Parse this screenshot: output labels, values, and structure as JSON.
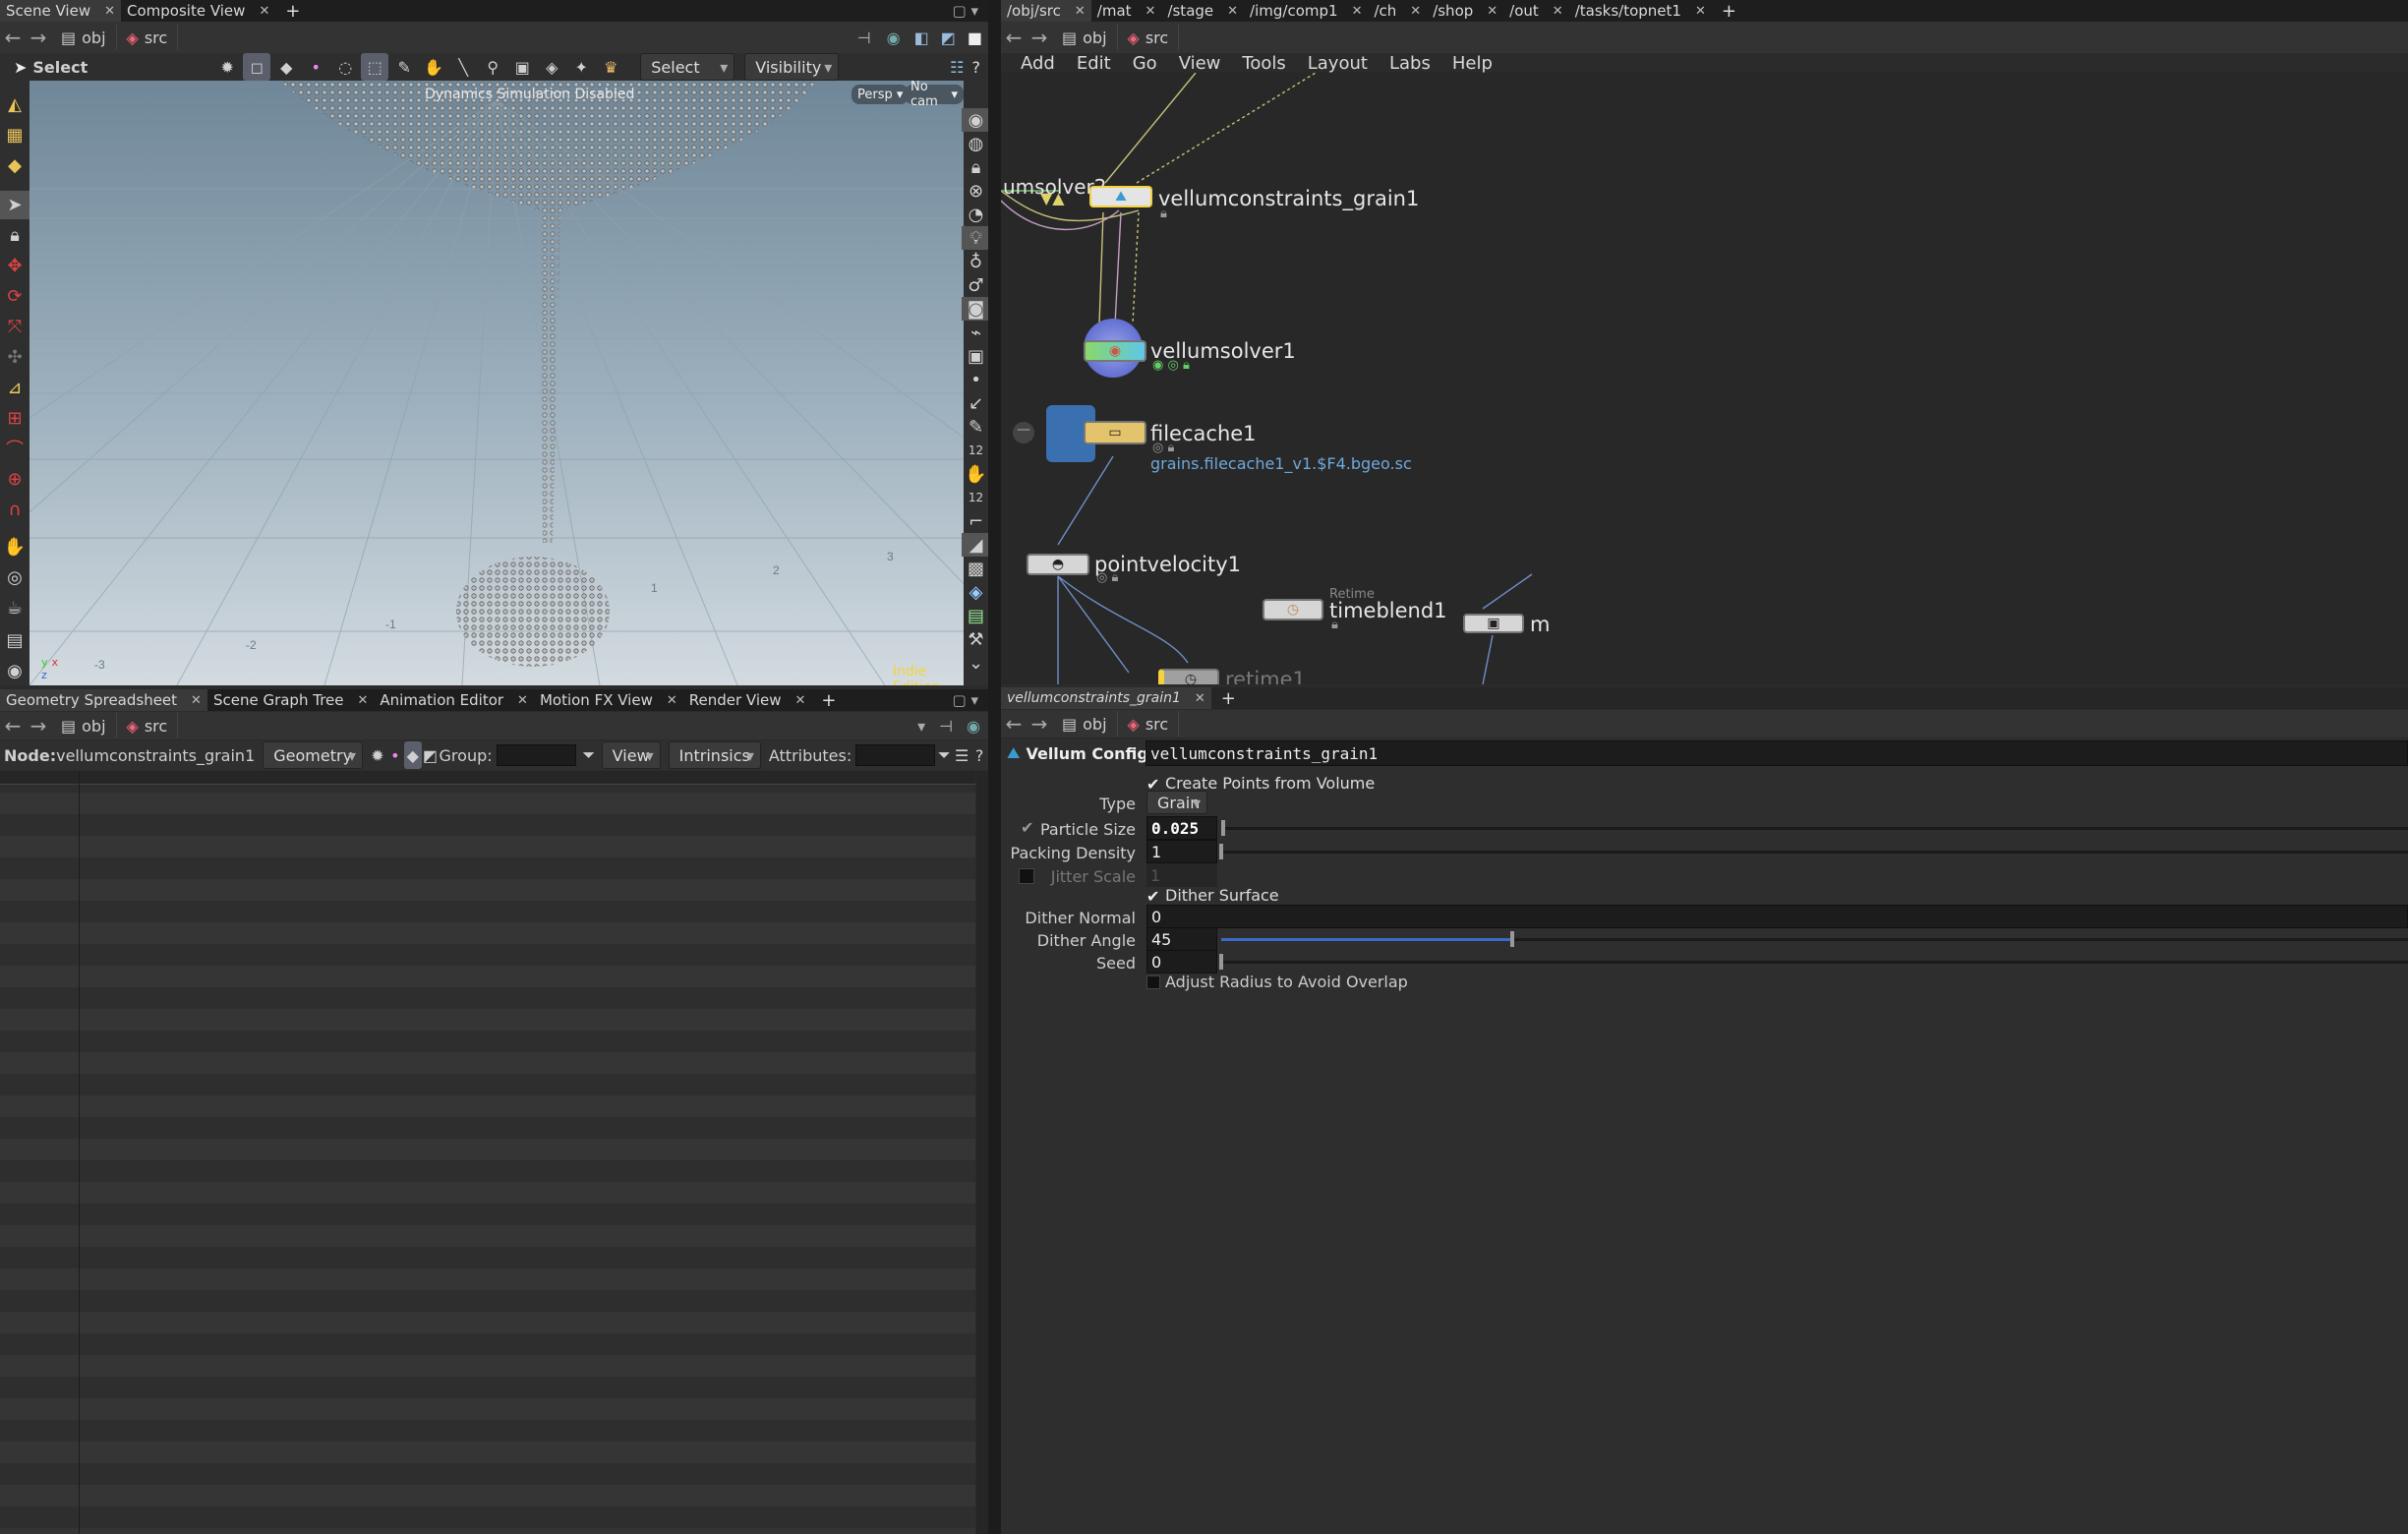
{
  "left_tabs": {
    "items": [
      "Scene View",
      "Composite View"
    ],
    "active": 0
  },
  "path": {
    "obj": "obj",
    "src": "src"
  },
  "toolbar": {
    "mode": "Select",
    "select_dd": "Select",
    "visibility_dd": "Visibility"
  },
  "viewport": {
    "status": "Dynamics Simulation Disabled",
    "persp": "Persp",
    "cam": "No cam",
    "edition": "Indie Edition",
    "grid_labels": [
      "-1",
      "-2",
      "-3",
      "1",
      "2",
      "3"
    ]
  },
  "bottom_tabs": {
    "items": [
      "Geometry Spreadsheet",
      "Scene Graph Tree",
      "Animation Editor",
      "Motion FX View",
      "Render View"
    ],
    "active": 0
  },
  "spreadsheet": {
    "node_label": "Node:",
    "node_name": "vellumconstraints_grain1",
    "geometry_dd": "Geometry",
    "group_label": "Group:",
    "view_dd": "View",
    "intrinsics_dd": "Intrinsics",
    "attributes_label": "Attributes:"
  },
  "network_tabs": {
    "items": [
      "/obj/src",
      "/mat",
      "/stage",
      "/img/comp1",
      "/ch",
      "/shop",
      "/out",
      "/tasks/topnet1"
    ],
    "active": 0
  },
  "network_menu": [
    "Add",
    "Edit",
    "Go",
    "View",
    "Tools",
    "Layout",
    "Labs",
    "Help"
  ],
  "nodes": {
    "umsolver": "umsolver2",
    "constraints": "vellumconstraints_grain1",
    "solver": "vellumsolver1",
    "filecache": "filecache1",
    "filecache_path": "grains.filecache1_v1.$F4.bgeo.sc",
    "pointvelocity": "pointvelocity1",
    "timeblend_tag": "Retime",
    "timeblend": "timeblend1",
    "retime": "retime1",
    "m": "m"
  },
  "parm_tab": "vellumconstraints_grain1",
  "parms": {
    "type_label": "Vellum Configure Grain",
    "node_name": "vellumconstraints_grain1",
    "create_points": "Create Points from Volume",
    "type": "Type",
    "type_val": "Grain",
    "particle_size": "Particle Size",
    "particle_size_val": "0.025",
    "packing_density": "Packing Density",
    "packing_density_val": "1",
    "jitter_scale": "Jitter Scale",
    "jitter_scale_val": "1",
    "dither_surface": "Dither Surface",
    "dither_normal": "Dither Normal",
    "dither_normal_val": "0",
    "dither_angle": "Dither Angle",
    "dither_angle_val": "45",
    "seed": "Seed",
    "seed_val": "0",
    "adjust_radius": "Adjust Radius to Avoid Overlap"
  },
  "colors": {
    "accent": "#f5d23b",
    "link": "#6fa8dc",
    "viewport_top": "#6f8799",
    "viewport_bottom": "#cfd8de"
  }
}
